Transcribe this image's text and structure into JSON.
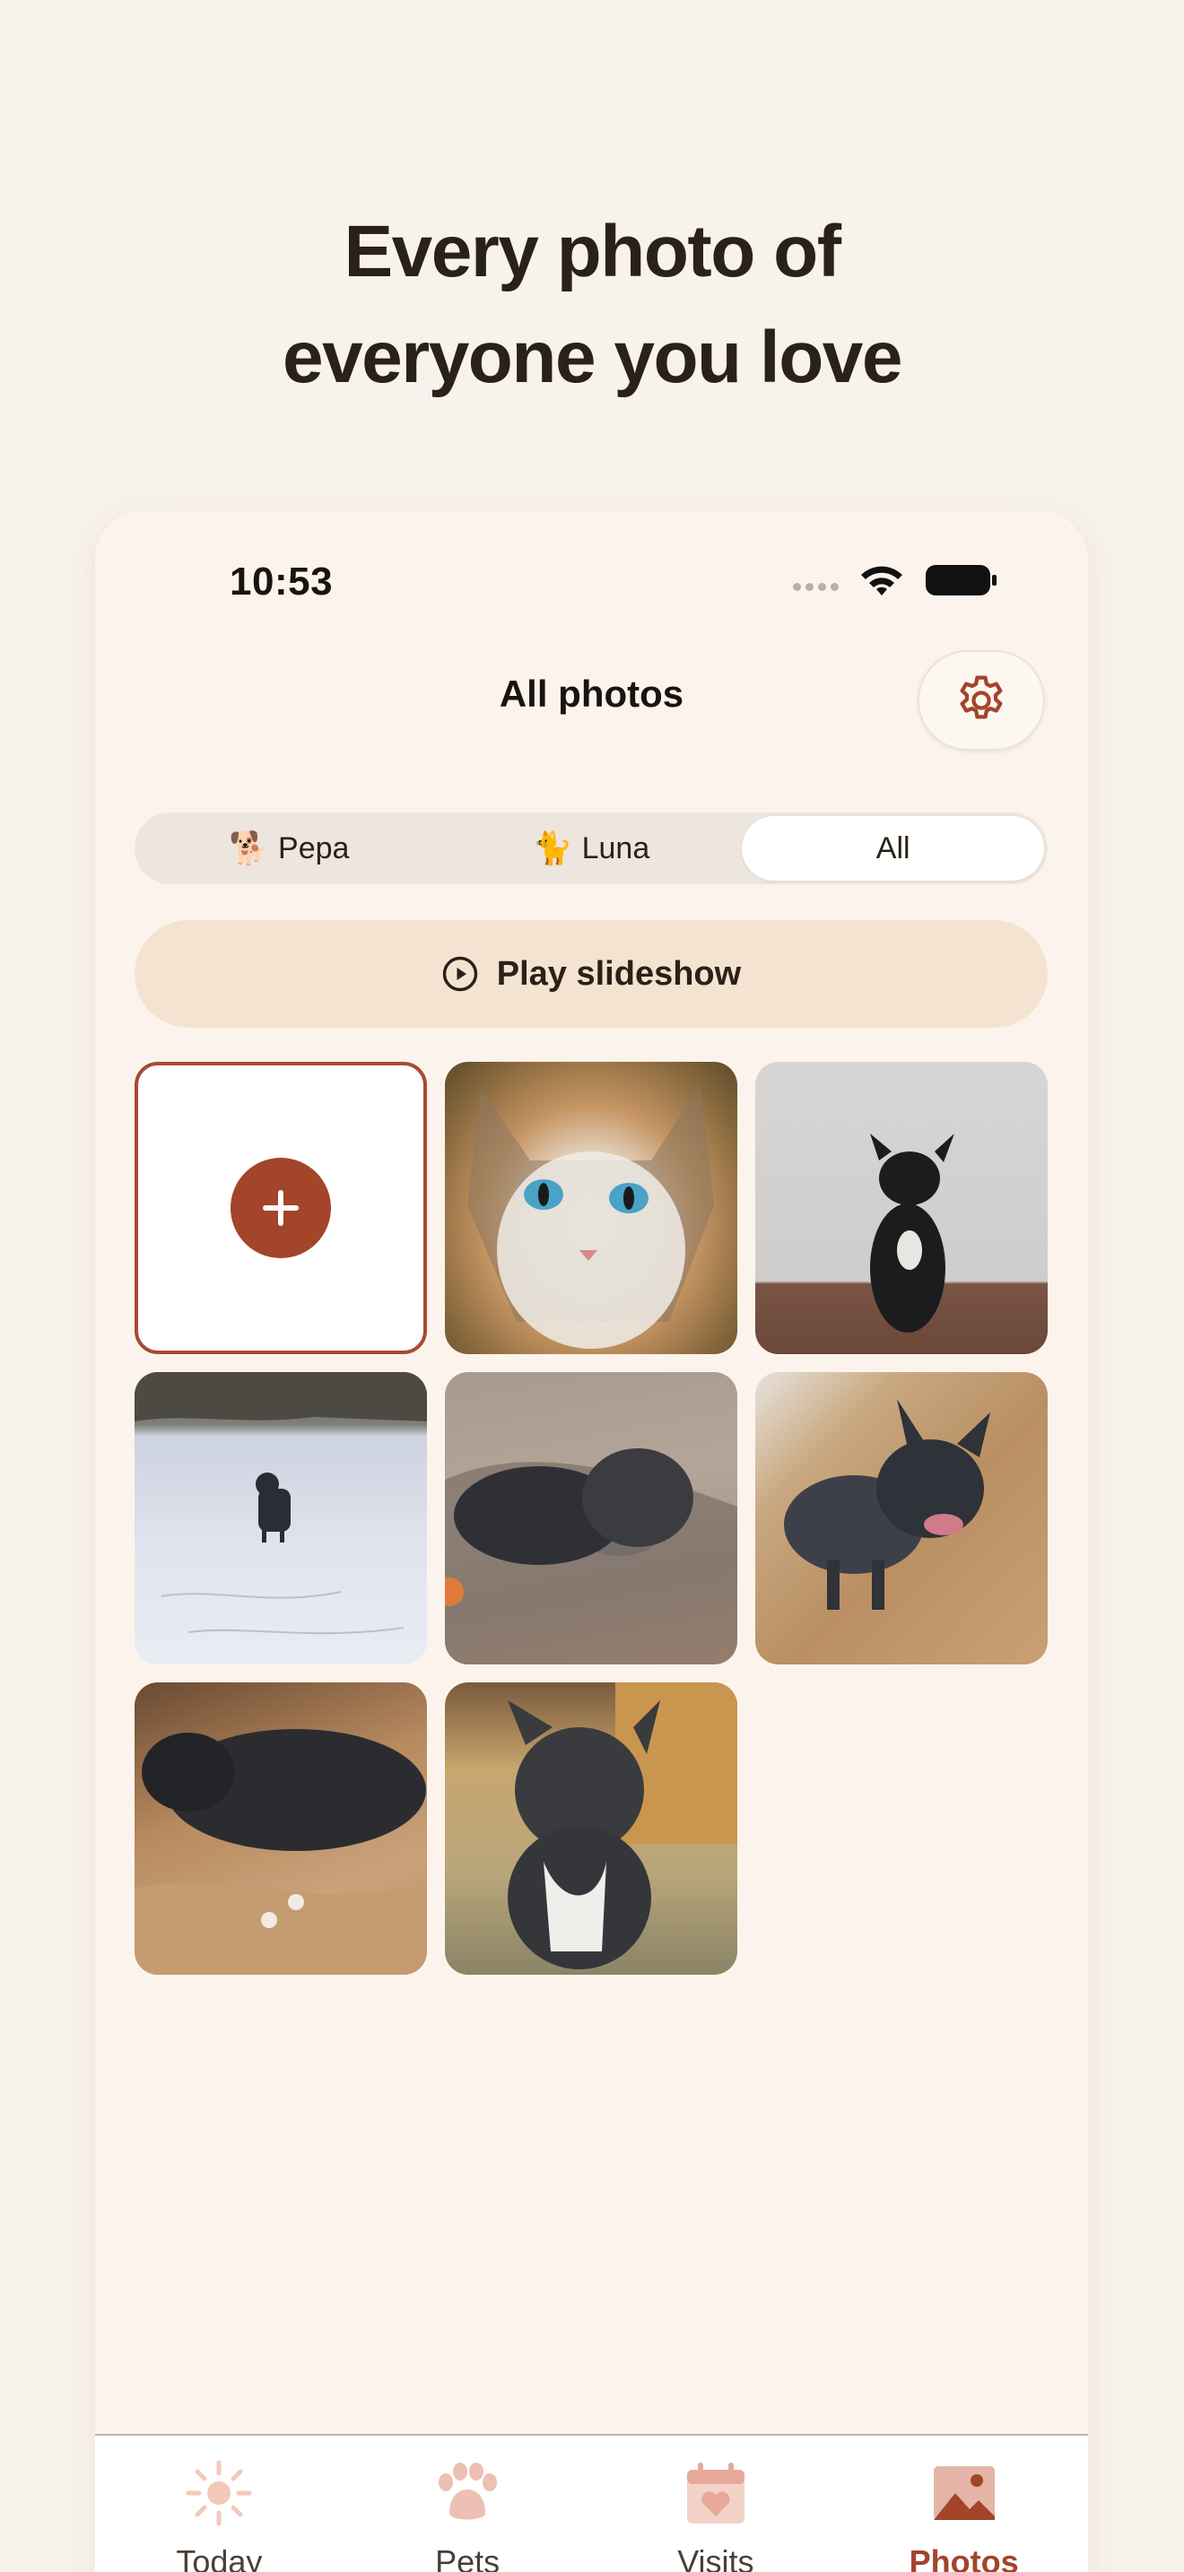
{
  "headline": {
    "line1": "Every photo of",
    "line2": "everyone you love"
  },
  "status": {
    "time": "10:53"
  },
  "nav": {
    "title": "All photos"
  },
  "segments": [
    {
      "emoji": "🐕",
      "label": "Pepa"
    },
    {
      "emoji": "🐈",
      "label": "Luna"
    },
    {
      "emoji": "",
      "label": "All"
    }
  ],
  "slideshow": {
    "label": "Play slideshow"
  },
  "photos": [
    {
      "subject": "cat"
    },
    {
      "subject": "dog"
    },
    {
      "subject": "dog"
    },
    {
      "subject": "dog"
    },
    {
      "subject": "dog"
    },
    {
      "subject": "dog"
    },
    {
      "subject": "dog"
    }
  ],
  "tabs": [
    {
      "label": "Today",
      "icon": "sun-icon"
    },
    {
      "label": "Pets",
      "icon": "paw-icon"
    },
    {
      "label": "Visits",
      "icon": "calendar-heart-icon"
    },
    {
      "label": "Photos",
      "icon": "photo-icon"
    }
  ],
  "colors": {
    "accent": "#a3442b",
    "background": "#f8f2ec",
    "slideshow_bg": "#f5e3d2"
  }
}
